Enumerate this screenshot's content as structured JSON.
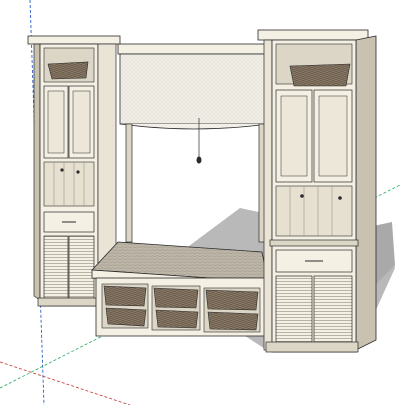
{
  "scene": {
    "subject": "",
    "colors": {
      "background": "#ffffff",
      "cabinet_light": "#f4f0e4",
      "cabinet_shade": "#dcd6c6",
      "cabinet_side": "#c9c2b0",
      "outline": "#2a2a2a",
      "shadow": "#b9b9b9",
      "basket": "#8a7a66",
      "basket_dark": "#5e5244",
      "cushion": "#bdb6a8",
      "shade_fabric": "#f1efe8",
      "axis_red": "#c0392b",
      "axis_green": "#27ae60",
      "axis_blue": "#2c5fc9"
    }
  }
}
